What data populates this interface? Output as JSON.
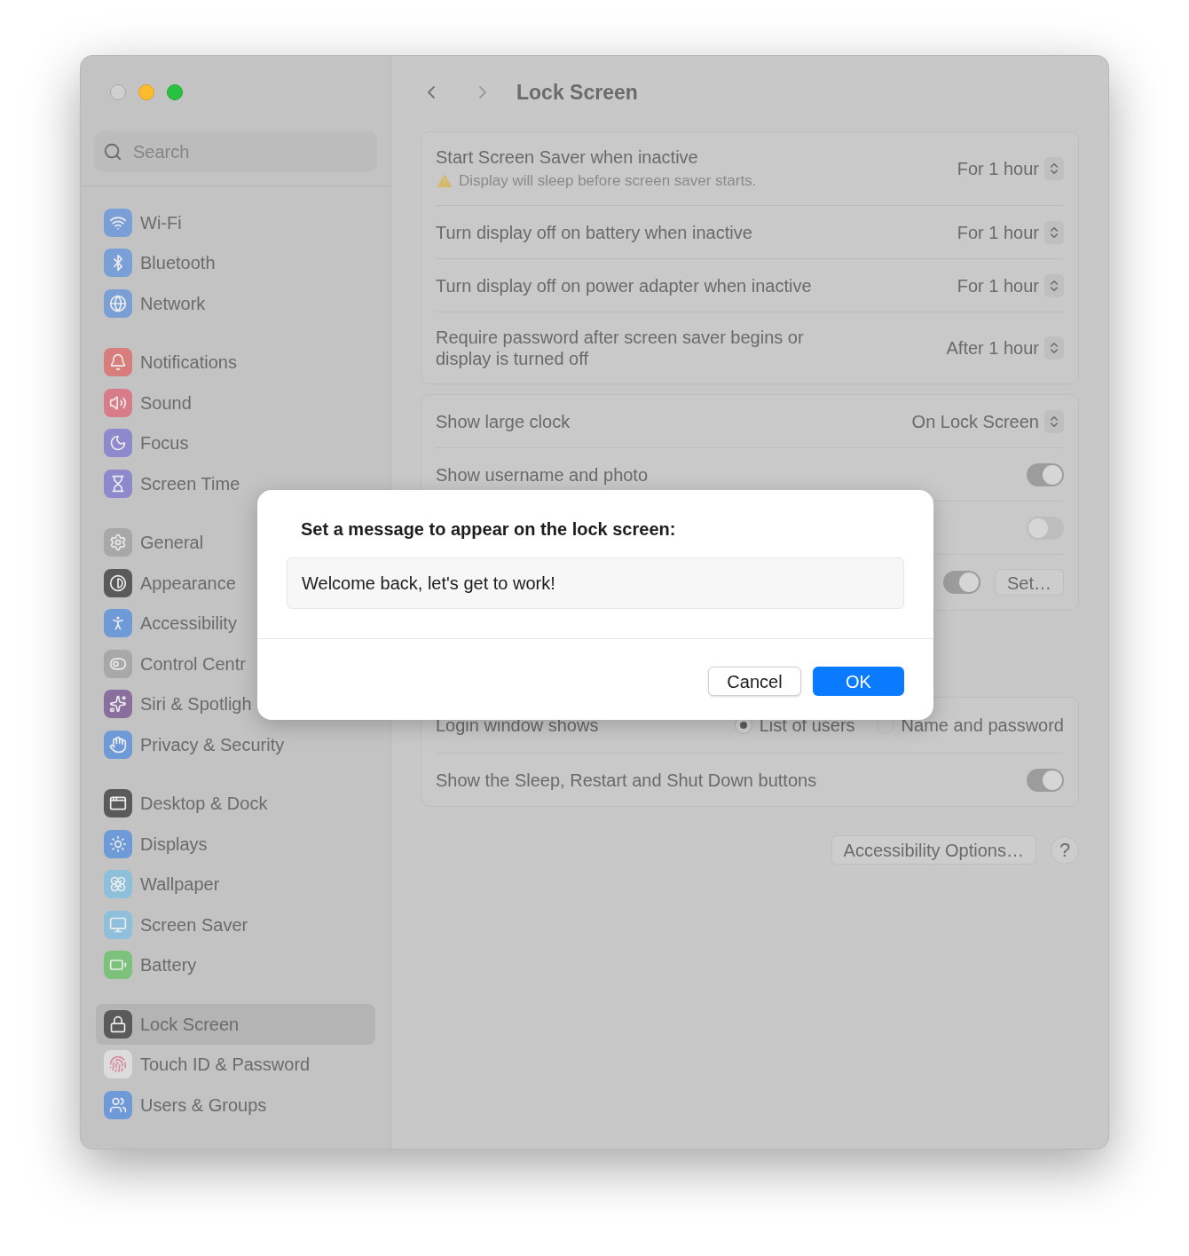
{
  "window": {
    "controls": [
      {
        "kind": "close",
        "color": "#d0d0d0"
      },
      {
        "kind": "minimize",
        "color": "#fdbb2d"
      },
      {
        "kind": "zoom",
        "color": "#27c23f"
      }
    ]
  },
  "sidebar": {
    "search": {
      "placeholder": "Search"
    },
    "groups": [
      {
        "items": [
          {
            "label": "Wi-Fi",
            "color": "#7a9fd6",
            "selected": false
          },
          {
            "label": "Bluetooth",
            "color": "#7a9fd6",
            "selected": false
          },
          {
            "label": "Network",
            "color": "#7a9fd6",
            "selected": false
          }
        ]
      },
      {
        "items": [
          {
            "label": "Notifications",
            "color": "#d97c7c",
            "selected": false
          },
          {
            "label": "Sound",
            "color": "#d97c89",
            "selected": false
          },
          {
            "label": "Focus",
            "color": "#8e88cc",
            "selected": false
          },
          {
            "label": "Screen Time",
            "color": "#8e88cc",
            "selected": false
          }
        ]
      },
      {
        "items": [
          {
            "label": "General",
            "color": "#a8a8a8",
            "selected": false
          },
          {
            "label": "Appearance",
            "color": "#5a5a5a",
            "selected": false
          },
          {
            "label": "Accessibility",
            "color": "#6f9ad8",
            "selected": false
          },
          {
            "label": "Control Centr",
            "color": "#a8a8a8",
            "selected": false
          },
          {
            "label": "Siri & Spotligh",
            "color": "#8a6f9e",
            "selected": false
          },
          {
            "label": "Privacy & Security",
            "color": "#6f9ad8",
            "selected": false
          }
        ]
      },
      {
        "items": [
          {
            "label": "Desktop & Dock",
            "color": "#5a5a5a",
            "selected": false
          },
          {
            "label": "Displays",
            "color": "#6f9ad8",
            "selected": false
          },
          {
            "label": "Wallpaper",
            "color": "#8ec0dc",
            "selected": false
          },
          {
            "label": "Screen Saver",
            "color": "#8ec0dc",
            "selected": false
          },
          {
            "label": "Battery",
            "color": "#7cc27c",
            "selected": false
          }
        ]
      },
      {
        "items": [
          {
            "label": "Lock Screen",
            "color": "#5a5a5a",
            "selected": true
          },
          {
            "label": "Touch ID & Password",
            "color": "#dcdcdc",
            "selected": false
          },
          {
            "label": "Users & Groups",
            "color": "#6f9ad8",
            "selected": false
          }
        ]
      }
    ]
  },
  "page": {
    "title": "Lock Screen",
    "sections": [
      {
        "rows": [
          {
            "kind": "popup",
            "label": "Start Screen Saver when inactive",
            "note": "Display will sleep before screen saver starts.",
            "value": "For 1 hour"
          },
          {
            "kind": "popup",
            "label": "Turn display off on battery when inactive",
            "value": "For 1 hour"
          },
          {
            "kind": "popup",
            "label": "Turn display off on power adapter when inactive",
            "value": "For 1 hour"
          },
          {
            "kind": "popup",
            "label": "Require password after screen saver begins or display is turned off",
            "value": "After 1 hour"
          }
        ]
      },
      {
        "rows": [
          {
            "kind": "popup",
            "label": "Show large clock",
            "value": "On Lock Screen"
          },
          {
            "kind": "toggle",
            "label": "Show username and photo",
            "on": true
          },
          {
            "kind": "toggle",
            "on": false
          },
          {
            "kind": "toggle",
            "on": true,
            "button": "Set…"
          }
        ]
      },
      {
        "rows": [
          {
            "kind": "radio",
            "label": "Login window shows",
            "options": [
              {
                "label": "List of users",
                "selected": true
              },
              {
                "label": "Name and password",
                "selected": false
              }
            ]
          },
          {
            "kind": "toggle",
            "label": "Show the Sleep, Restart and Shut Down buttons",
            "on": true
          }
        ]
      }
    ],
    "footer": {
      "button": "Accessibility Options…",
      "help": "?"
    }
  },
  "dialog": {
    "title": "Set a message to appear on the lock screen:",
    "value": "Welcome back, let's get to work!",
    "buttons": [
      {
        "label": "Cancel",
        "primary": false
      },
      {
        "label": "OK",
        "primary": true
      }
    ]
  }
}
